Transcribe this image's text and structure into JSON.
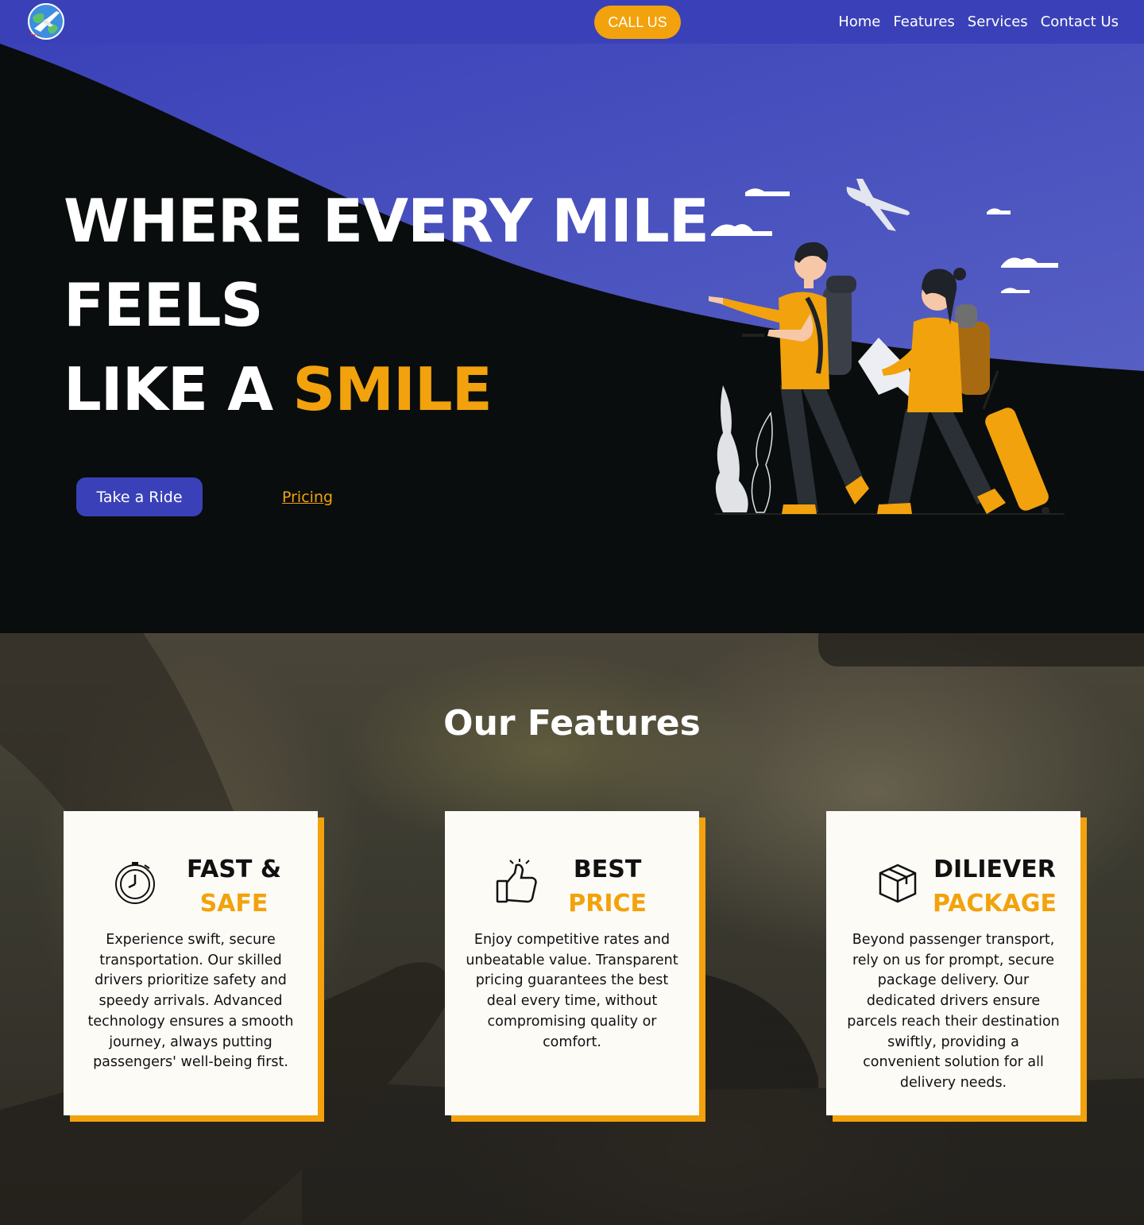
{
  "nav": {
    "call_label": "CALL US",
    "links": [
      "Home",
      "Features",
      "Services",
      "Contact Us"
    ]
  },
  "hero": {
    "title_line1": "WHERE EVERY MILE",
    "title_line2": "FEELS",
    "title_line3_prefix": "LIKE A ",
    "title_line3_accent": "SMILE",
    "ride_button": "Take a Ride",
    "pricing_link": "Pricing"
  },
  "features": {
    "title": "Our Features",
    "cards": [
      {
        "title_top": "FAST &",
        "title_bottom": "SAFE",
        "icon": "stopwatch-icon",
        "text": "Experience swift, secure transportation. Our skilled drivers prioritize safety and speedy arrivals. Advanced technology ensures a smooth journey, always putting passengers' well-being first."
      },
      {
        "title_top": "BEST",
        "title_bottom": "PRICE",
        "icon": "thumbs-up-icon",
        "text": "Enjoy competitive rates and unbeatable value. Transparent pricing guarantees the best deal every time, without compromising quality or comfort."
      },
      {
        "title_top": "DILIEVER",
        "title_bottom": "PACKAGE",
        "icon": "package-box-icon",
        "text": "Beyond passenger transport, rely on us for prompt, secure package delivery. Our dedicated drivers ensure parcels reach their destination swiftly, providing a convenient solution for all delivery needs."
      }
    ]
  },
  "colors": {
    "brand_blue": "#3a41b8",
    "accent_orange": "#f2a20c",
    "hero_dark": "#0a0d0d",
    "card_bg": "#fcfbf6"
  }
}
